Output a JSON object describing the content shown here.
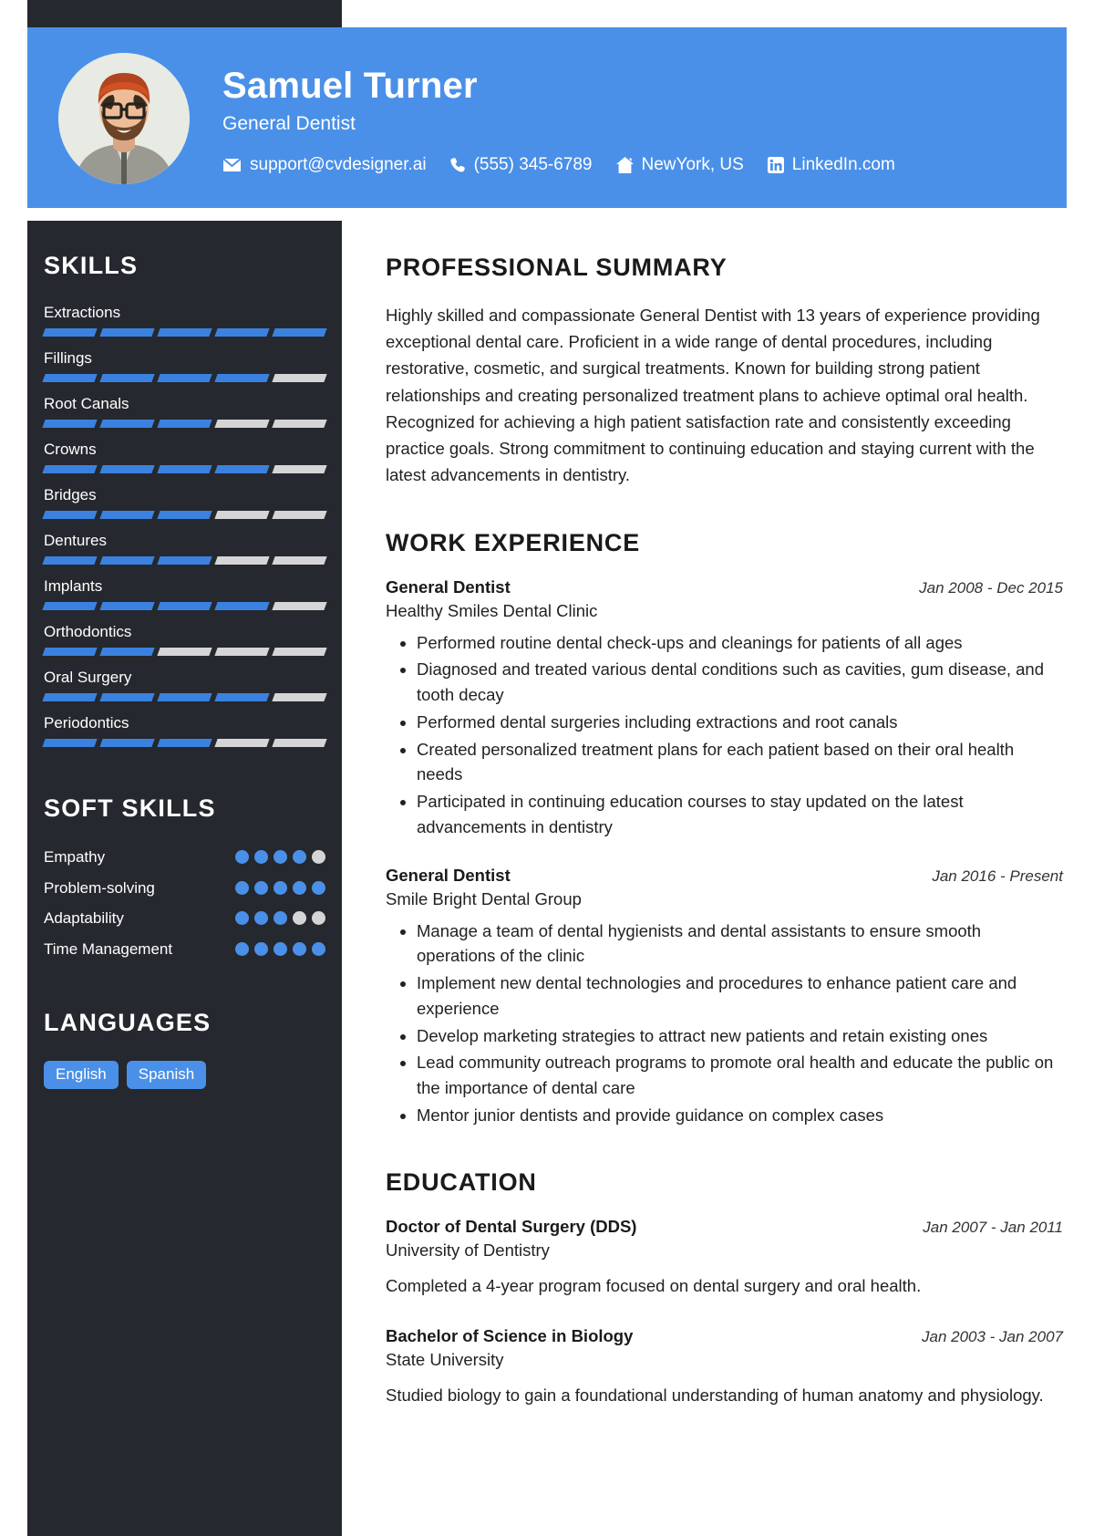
{
  "header": {
    "name": "Samuel Turner",
    "role": "General Dentist",
    "avatar_alt": "profile-photo",
    "contacts": [
      {
        "icon": "envelope-icon",
        "text": "support@cvdesigner.ai"
      },
      {
        "icon": "phone-icon",
        "text": "(555) 345-6789"
      },
      {
        "icon": "home-icon",
        "text": "NewYork, US"
      },
      {
        "icon": "linkedin-icon",
        "text": "LinkedIn.com"
      }
    ]
  },
  "colors": {
    "accent": "#4a90e8",
    "bar_filled": "#3b82e0",
    "bar_empty": "#d5d5d5",
    "sidebar_bg": "#25282e",
    "text_dark": "#1a1a1a"
  },
  "sidebar": {
    "skills_heading": "SKILLS",
    "skills_max": 5,
    "skills": [
      {
        "label": "Extractions",
        "level": 5
      },
      {
        "label": "Fillings",
        "level": 4
      },
      {
        "label": "Root Canals",
        "level": 3
      },
      {
        "label": "Crowns",
        "level": 4
      },
      {
        "label": "Bridges",
        "level": 3
      },
      {
        "label": "Dentures",
        "level": 3
      },
      {
        "label": "Implants",
        "level": 4
      },
      {
        "label": "Orthodontics",
        "level": 2
      },
      {
        "label": "Oral Surgery",
        "level": 4
      },
      {
        "label": "Periodontics",
        "level": 3
      }
    ],
    "soft_skills_heading": "SOFT SKILLS",
    "soft_skills_max": 5,
    "soft_skills": [
      {
        "label": "Empathy",
        "level": 4
      },
      {
        "label": "Problem-solving",
        "level": 5
      },
      {
        "label": "Adaptability",
        "level": 3
      },
      {
        "label": "Time Management",
        "level": 5
      }
    ],
    "languages_heading": "LANGUAGES",
    "languages": [
      "English",
      "Spanish"
    ]
  },
  "main": {
    "summary_heading": "PROFESSIONAL SUMMARY",
    "summary_text": "Highly skilled and compassionate General Dentist with 13 years of experience providing exceptional dental care. Proficient in a wide range of dental procedures, including restorative, cosmetic, and surgical treatments. Known for building strong patient relationships and creating personalized treatment plans to achieve optimal oral health. Recognized for achieving a high patient satisfaction rate and consistently exceeding practice goals. Strong commitment to continuing education and staying current with the latest advancements in dentistry.",
    "work_heading": "WORK EXPERIENCE",
    "work": [
      {
        "title": "General Dentist",
        "date": "Jan 2008 - Dec 2015",
        "organization": "Healthy Smiles Dental Clinic",
        "bullets": [
          "Performed routine dental check-ups and cleanings for patients of all ages",
          "Diagnosed and treated various dental conditions such as cavities, gum disease, and tooth decay",
          "Performed dental surgeries including extractions and root canals",
          "Created personalized treatment plans for each patient based on their oral health needs",
          "Participated in continuing education courses to stay updated on the latest advancements in dentistry"
        ]
      },
      {
        "title": "General Dentist",
        "date": "Jan 2016 - Present",
        "organization": "Smile Bright Dental Group",
        "bullets": [
          "Manage a team of dental hygienists and dental assistants to ensure smooth operations of the clinic",
          "Implement new dental technologies and procedures to enhance patient care and experience",
          "Develop marketing strategies to attract new patients and retain existing ones",
          "Lead community outreach programs to promote oral health and educate the public on the importance of dental care",
          "Mentor junior dentists and provide guidance on complex cases"
        ]
      }
    ],
    "education_heading": "EDUCATION",
    "education": [
      {
        "title": "Doctor of Dental Surgery (DDS)",
        "date": "Jan 2007 - Jan 2011",
        "organization": "University of Dentistry",
        "description": "Completed a 4-year program focused on dental surgery and oral health."
      },
      {
        "title": "Bachelor of Science in Biology",
        "date": "Jan 2003 - Jan 2007",
        "organization": "State University",
        "description": "Studied biology to gain a foundational understanding of human anatomy and physiology."
      }
    ]
  }
}
